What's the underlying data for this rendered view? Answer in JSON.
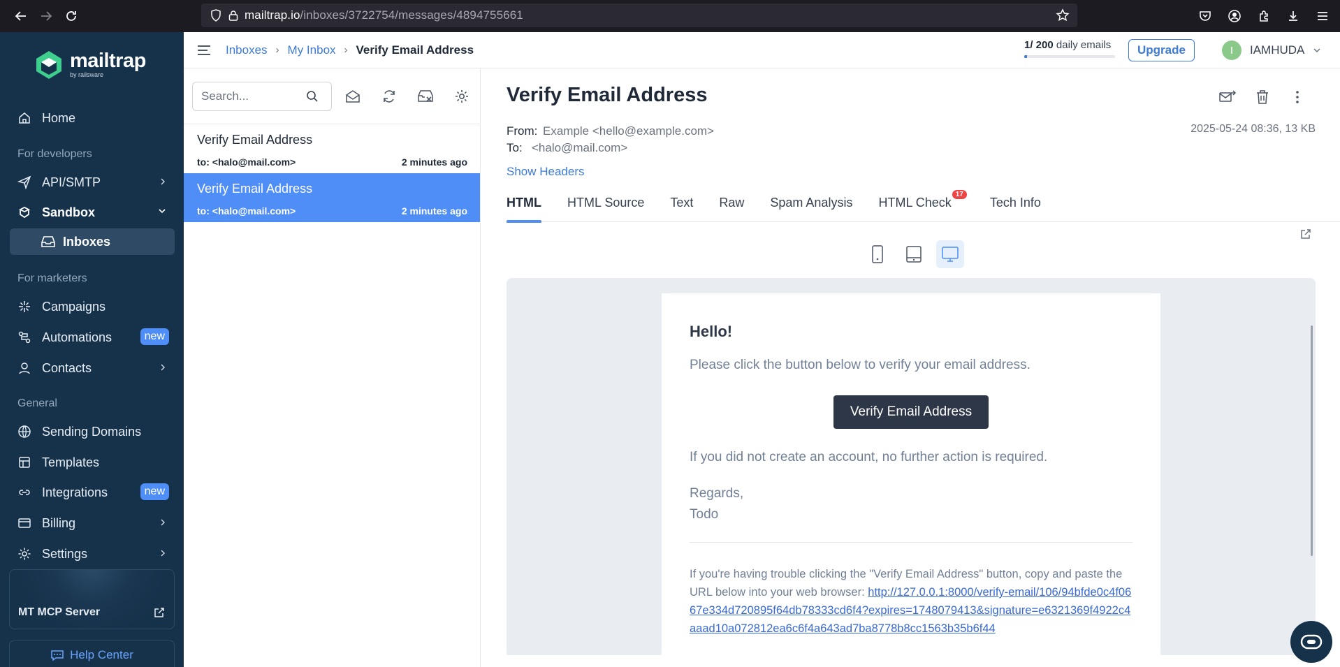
{
  "browser": {
    "url_host": "mailtrap.io",
    "url_path": "/inboxes/3722754/messages/4894755661"
  },
  "sidebar": {
    "logo_name": "mailtrap",
    "logo_by": "by railsware",
    "home": "Home",
    "section_developers": "For developers",
    "api_smtp": "API/SMTP",
    "sandbox": "Sandbox",
    "inboxes": "Inboxes",
    "section_marketers": "For marketers",
    "campaigns": "Campaigns",
    "automations": "Automations",
    "automations_badge": "new",
    "contacts": "Contacts",
    "section_general": "General",
    "sending_domains": "Sending Domains",
    "templates": "Templates",
    "integrations": "Integrations",
    "integrations_badge": "new",
    "billing": "Billing",
    "settings": "Settings",
    "mcp_server": "MT MCP Server",
    "help_center": "Help Center"
  },
  "header": {
    "breadcrumb": [
      "Inboxes",
      "My Inbox",
      "Verify Email Address"
    ],
    "quota_used": "1",
    "quota_total": "/ 200",
    "quota_label": " daily emails",
    "quota_fraction": 0.005,
    "upgrade": "Upgrade",
    "avatar_initial": "I",
    "username": "IAMHUDA"
  },
  "list": {
    "search_placeholder": "Search...",
    "messages": [
      {
        "subject": "Verify Email Address",
        "to": "to: <halo@mail.com>",
        "time": "2 minutes ago"
      },
      {
        "subject": "Verify Email Address",
        "to": "to: <halo@mail.com>",
        "time": "2 minutes ago"
      }
    ]
  },
  "detail": {
    "title": "Verify Email Address",
    "from_label": "From:",
    "from_value": "Example <hello@example.com>",
    "to_label": "To:",
    "to_value": "<halo@mail.com>",
    "date_size": "2025-05-24 08:36, 13 KB",
    "show_headers": "Show Headers",
    "tabs": [
      "HTML",
      "HTML Source",
      "Text",
      "Raw",
      "Spam Analysis",
      "HTML Check",
      "Tech Info"
    ],
    "html_check_badge": "17"
  },
  "email": {
    "greeting": "Hello!",
    "intro": "Please click the button below to verify your email address.",
    "button": "Verify Email Address",
    "outro": "If you did not create an account, no further action is required.",
    "regards": "Regards,",
    "signature": "Todo",
    "subcopy": "If you're having trouble clicking the \"Verify Email Address\" button, copy and paste the URL below into your web browser: ",
    "link": "http://127.0.0.1:8000/verify-email/106/94bfde0c4f0667e334d720895f64db78333cd6f4?expires=1748079413&signature=e6321369f4922c4aaad10a072812ea6c6f4a643ad7ba8778b8cc1563b35b6f44"
  },
  "colors": {
    "sidebar": "#16324b",
    "accent": "#4f8ef7",
    "link": "#3e7bd6"
  }
}
